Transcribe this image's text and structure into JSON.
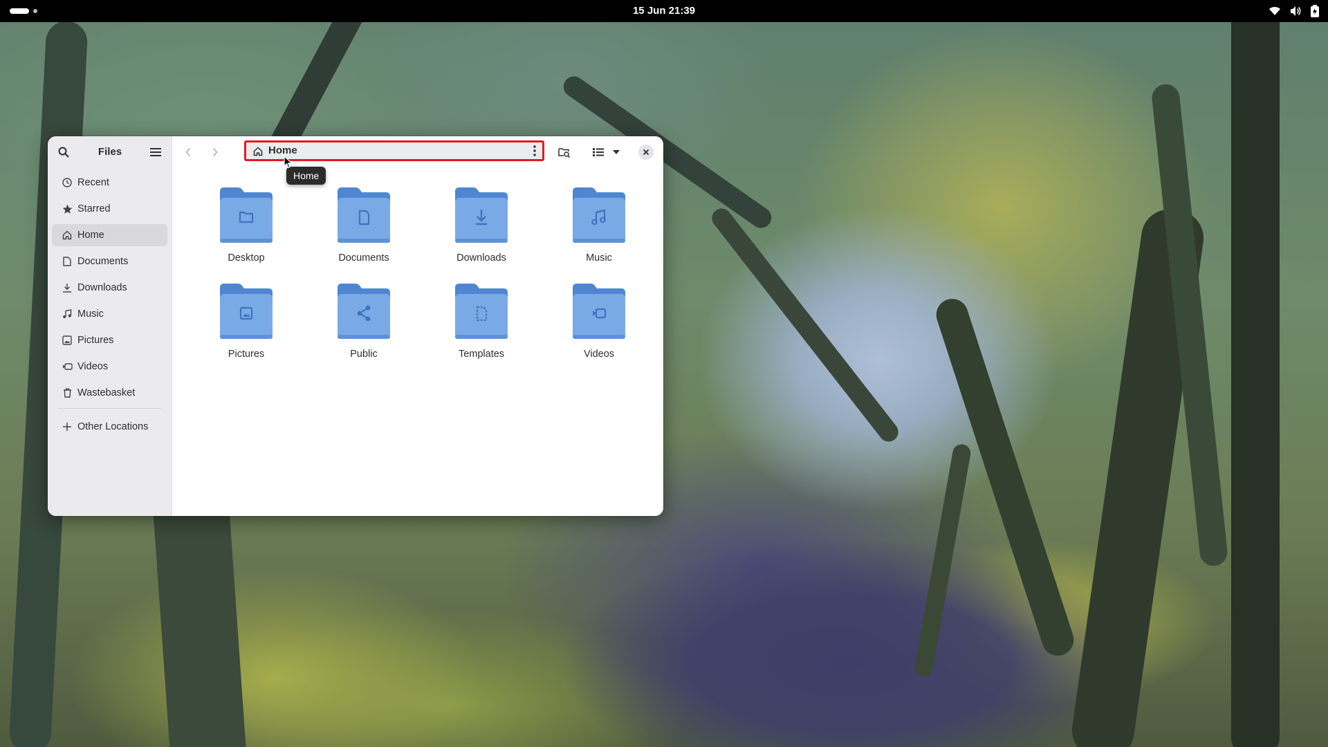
{
  "topbar": {
    "clock": "15 Jun  21:39",
    "tray_icons": [
      "wifi-icon",
      "volume-icon",
      "battery-icon"
    ]
  },
  "window": {
    "title": "Files",
    "location": "Home",
    "tooltip": "Home",
    "accent_color": "#e01b24",
    "folder_color": "#6a9de0"
  },
  "sidebar": {
    "items": [
      {
        "label": "Recent",
        "icon": "clock-icon"
      },
      {
        "label": "Starred",
        "icon": "star-icon"
      },
      {
        "label": "Home",
        "icon": "home-icon",
        "active": true
      },
      {
        "label": "Documents",
        "icon": "document-icon"
      },
      {
        "label": "Downloads",
        "icon": "download-icon"
      },
      {
        "label": "Music",
        "icon": "music-icon"
      },
      {
        "label": "Pictures",
        "icon": "picture-icon"
      },
      {
        "label": "Videos",
        "icon": "video-icon"
      },
      {
        "label": "Wastebasket",
        "icon": "trash-icon"
      }
    ],
    "other": {
      "label": "Other Locations",
      "icon": "plus-icon"
    }
  },
  "folders": [
    {
      "name": "Desktop",
      "icon": "folder-icon"
    },
    {
      "name": "Documents",
      "icon": "document-icon"
    },
    {
      "name": "Downloads",
      "icon": "download-icon"
    },
    {
      "name": "Music",
      "icon": "music-icon"
    },
    {
      "name": "Pictures",
      "icon": "picture-icon"
    },
    {
      "name": "Public",
      "icon": "share-icon"
    },
    {
      "name": "Templates",
      "icon": "template-icon"
    },
    {
      "name": "Videos",
      "icon": "video-icon"
    }
  ]
}
